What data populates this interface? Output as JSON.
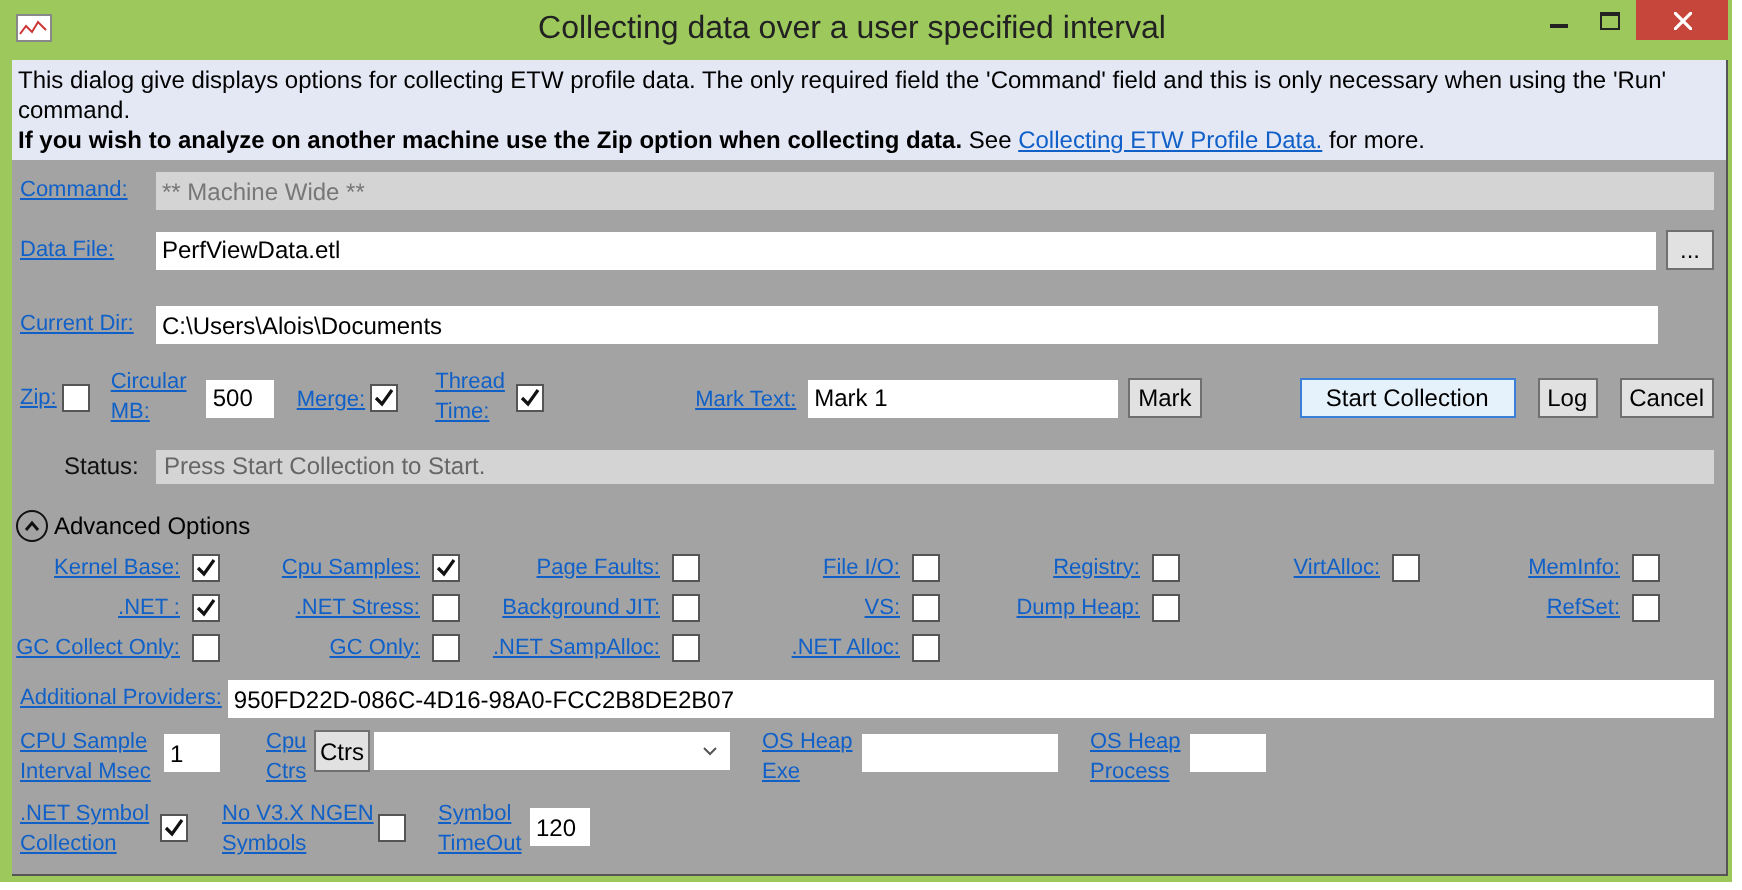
{
  "window": {
    "title": "Collecting data over a user specified interval"
  },
  "info": {
    "text": "This dialog give displays options for collecting ETW profile data. The only required field the 'Command' field and this is only necessary when using the 'Run' command.",
    "note": "**If you wish to analyze on another machine use the Zip option when collecting data.** See",
    "link": "Collecting ETW Profile Data.",
    "after_link": "for more."
  },
  "command": {
    "label": "Command:",
    "value": "** Machine Wide **",
    "disabled": true
  },
  "data_file": {
    "label": "Data File:",
    "value": "PerfViewData.etl",
    "browse": "..."
  },
  "current_dir": {
    "label": "Current Dir:",
    "value": "C:\\Users\\Alois\\Documents"
  },
  "zip": {
    "label": "Zip:",
    "checked": false
  },
  "circular_mb": {
    "label": "Circular MB:",
    "value": "500"
  },
  "merge": {
    "label": "Merge:",
    "checked": true
  },
  "thread_time": {
    "label": "Thread Time:",
    "checked": true
  },
  "mark_text": {
    "label": "Mark Text:",
    "value": "Mark 1",
    "button": "Mark"
  },
  "buttons": [
    {
      "label": "Start Collection",
      "selected": true
    },
    {
      "label": "Log",
      "selected": false
    },
    {
      "label": "Cancel",
      "selected": false
    }
  ],
  "status": {
    "label": "Status:",
    "value": "Press Start Collection to Start."
  },
  "advanced": {
    "label": "Advanced Options",
    "expanded": true
  },
  "provider_columns": [
    [
      {
        "label": "Kernel Base:",
        "checked": true
      },
      {
        "label": ".NET :",
        "checked": true
      },
      {
        "label": "GC Collect Only:",
        "checked": false
      }
    ],
    [
      {
        "label": "Cpu Samples:",
        "checked": true
      },
      {
        "label": ".NET Stress:",
        "checked": false
      },
      {
        "label": "GC Only:",
        "checked": false
      }
    ],
    [
      {
        "label": "Page Faults:",
        "checked": false
      },
      {
        "label": "Background JIT:",
        "checked": false
      },
      {
        "label": ".NET SampAlloc:",
        "checked": false
      }
    ],
    [
      {
        "label": "File I/O:",
        "checked": false
      },
      {
        "label": "VS:",
        "checked": false
      },
      {
        "label": ".NET Alloc:",
        "checked": false
      }
    ],
    [
      {
        "label": "Registry:",
        "checked": false
      },
      {
        "label": "Dump Heap:",
        "checked": false
      }
    ],
    [
      {
        "label": "VirtAlloc:",
        "checked": false
      }
    ],
    [
      {
        "label": "MemInfo:",
        "checked": false
      },
      {
        "label": "RefSet:",
        "checked": false
      }
    ]
  ],
  "additional_providers": {
    "label": "Additional Providers:",
    "value": "950FD22D-086C-4D16-98A0-FCC2B8DE2B07"
  },
  "cpu_sample": {
    "label": "CPU Sample Interval Msec",
    "value": "1"
  },
  "cpu_ctrs": {
    "label": "Cpu Ctrs",
    "button": "Ctrs"
  },
  "os_heap_exe": {
    "label": "OS Heap Exe"
  },
  "os_heap_process": {
    "label": "OS Heap Process"
  },
  "net_symbol": {
    "label": ".NET Symbol Collection",
    "checked": true
  },
  "no_ngen": {
    "label": "No V3.X NGEN Symbols",
    "checked": false
  },
  "symbol_timeout": {
    "label": "Symbol TimeOut",
    "value": "120"
  }
}
